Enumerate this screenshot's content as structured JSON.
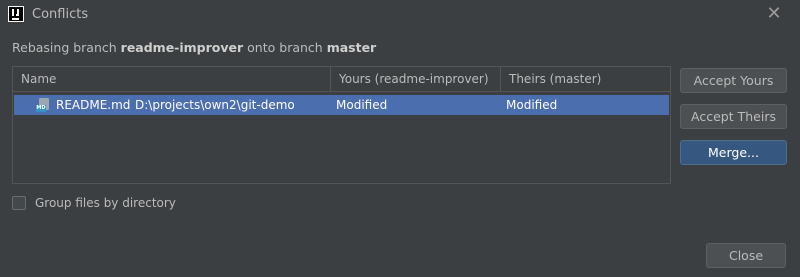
{
  "window": {
    "title": "Conflicts"
  },
  "header": {
    "prefix": "Rebasing branch ",
    "branch": "readme-improver",
    "middle": " onto branch ",
    "target": "master"
  },
  "table": {
    "columns": [
      "Name",
      "Yours (readme-improver)",
      "Theirs (master)"
    ],
    "rows": [
      {
        "file": "README.md",
        "path": "D:\\projects\\own2\\git-demo",
        "yours": "Modified",
        "theirs": "Modified",
        "icon": "markdown-file-icon"
      }
    ]
  },
  "buttons": {
    "accept_yours": "Accept Yours",
    "accept_theirs": "Accept Theirs",
    "merge": "Merge...",
    "close": "Close"
  },
  "options": {
    "group_label": "Group files by directory",
    "group_checked": false
  },
  "colors": {
    "background": "#3c3f41",
    "selection": "#4b6eaf",
    "primary_button": "#365880"
  }
}
